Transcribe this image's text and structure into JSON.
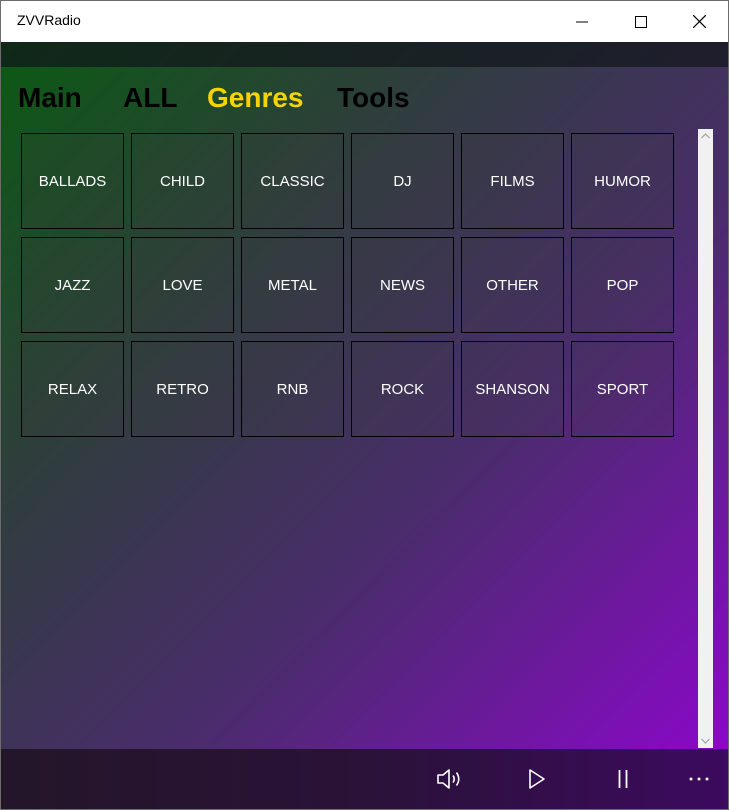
{
  "window": {
    "title": "ZVVRadio"
  },
  "nav": {
    "items": [
      {
        "label": "Main",
        "active": false
      },
      {
        "label": "ALL",
        "active": false
      },
      {
        "label": "Genres",
        "active": true
      },
      {
        "label": "Tools",
        "active": false
      }
    ]
  },
  "genres": [
    "BALLADS",
    "CHILD",
    "CLASSIC",
    "DJ",
    "FILMS",
    "HUMOR",
    "JAZZ",
    "LOVE",
    "METAL",
    "NEWS",
    "OTHER",
    "POP",
    "RELAX",
    "RETRO",
    "RNB",
    "ROCK",
    "SHANSON",
    "SPORT"
  ],
  "player": {
    "icons": [
      "volume-icon",
      "play-icon",
      "pause-icon",
      "more-icon"
    ]
  },
  "colors": {
    "active_tab": "#f5d400",
    "gradient_start": "#0a5a12",
    "gradient_end": "#8a08c8"
  }
}
